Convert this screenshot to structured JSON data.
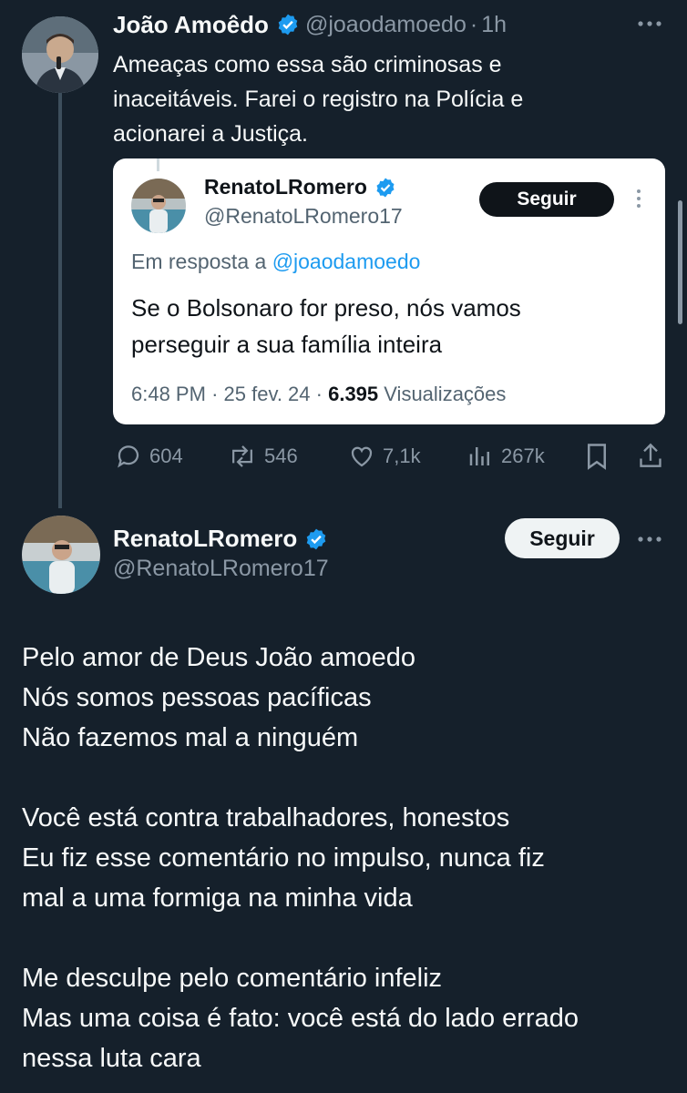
{
  "tweet": {
    "author_name": "João Amoêdo",
    "handle": "@joaodamoedo",
    "dot": "·",
    "time": "1h",
    "text_lines": [
      "Ameaças como essa são criminosas e",
      "inaceitáveis. Farei o registro na Polícia e",
      "acionarei a Justiça."
    ],
    "more_icon": "more-dots-icon",
    "stats": {
      "replies": "604",
      "retweets": "546",
      "likes": "7,1k",
      "views": "267k"
    }
  },
  "quote": {
    "author_name": "RenatoLRomero",
    "handle": "@RenatoLRomero17",
    "follow_label": "Seguir",
    "reply_prefix": "Em resposta a",
    "reply_to": "@joaodamoedo",
    "text_lines": [
      "Se o Bolsonaro for preso, nós vamos",
      "perseguir a sua família inteira"
    ],
    "time": "6:48 PM",
    "sep1": "·",
    "date": "25 fev. 24",
    "sep2": "·",
    "views_count": "6.395",
    "views_label": "Visualizações"
  },
  "reply": {
    "author_name": "RenatoLRomero",
    "handle": "@RenatoLRomero17",
    "follow_label": "Seguir",
    "para1": [
      "Pelo amor de Deus João amoedo",
      "Nós somos pessoas pacíficas",
      "Não fazemos mal a ninguém"
    ],
    "para2": [
      "Você está contra trabalhadores, honestos",
      "Eu fiz esse comentário no impulso, nunca fiz",
      "mal a uma formiga na minha vida"
    ],
    "para3": [
      "Me desculpe pelo comentário infeliz",
      "Mas uma coisa é fato: você está do lado errado",
      "nessa luta cara"
    ]
  },
  "colors": {
    "background": "#15202b",
    "verified": "#1d9bf0",
    "link": "#1d9bf0",
    "muted": "#8b98a5"
  }
}
